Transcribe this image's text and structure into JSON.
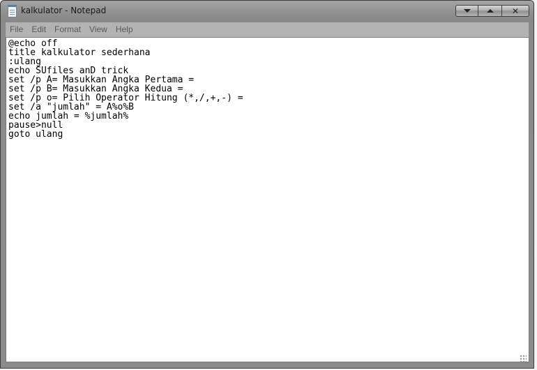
{
  "window": {
    "title": "kalkulator - Notepad",
    "icon": "notepad-icon"
  },
  "controls": {
    "minimize": "minimize-icon",
    "maximize": "maximize-icon",
    "close": "close-icon",
    "close_glyph": "✕"
  },
  "menu": {
    "items": [
      "File",
      "Edit",
      "Format",
      "View",
      "Help"
    ]
  },
  "editor": {
    "content": "@echo off\ntitle kalkulator sederhana\n:ulang\necho SUfiles anD trick\nset /p A= Masukkan Angka Pertama =\nset /p B= Masukkan Angka Kedua =\nset /p o= Pilih Operator Hitung (*,/,+,-) =\nset /a \"jumlah\" = A%o%B\necho jumlah = %jumlah%\npause>null\ngoto ulang"
  }
}
